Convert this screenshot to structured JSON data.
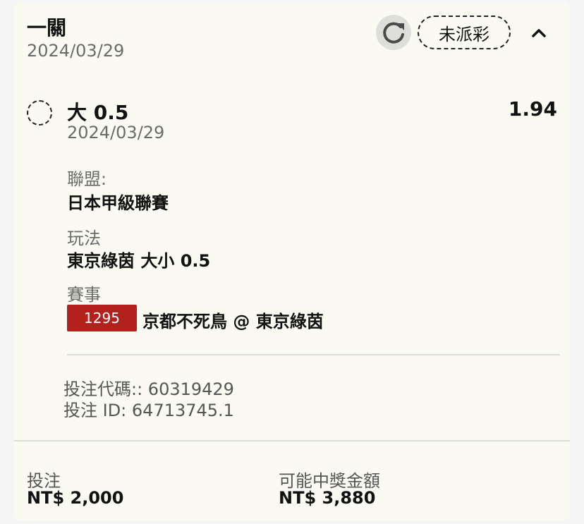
{
  "header": {
    "title": "一關",
    "date": "2024/03/29",
    "refresh_icon": "refresh-icon",
    "status_label": "未派彩",
    "collapse_icon": "chevron-up-icon"
  },
  "bet": {
    "selection": "大 0.5",
    "odds": "1.94",
    "date": "2024/03/29",
    "league_label": "聯盟:",
    "league_value": "日本甲級聯賽",
    "market_label": "玩法",
    "market_value": "東京綠茵 大小 0.5",
    "event_label": "賽事",
    "event_id": "1295",
    "event_name": "京都不死鳥 @ 東京綠茵"
  },
  "references": {
    "code_line": "投注代碼:: 60319429",
    "id_line": "投注 ID: 64713745.1"
  },
  "summary": {
    "stake_label": "投注",
    "stake_value": "NT$ 2,000",
    "payout_label": "可能中獎金額",
    "payout_value": "NT$ 3,880"
  },
  "colors": {
    "card_background": "#fbfaf2",
    "event_badge": "#b3211d",
    "muted_text": "#6b6b6b"
  }
}
